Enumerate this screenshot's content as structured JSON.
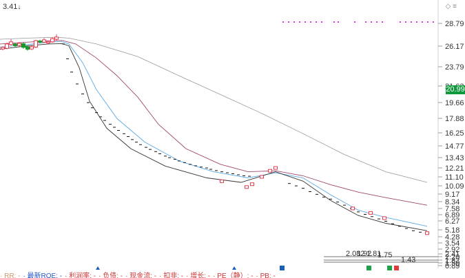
{
  "top_left_label": "3.41",
  "top_right_icons": [
    "diamond-icon",
    "menu-icon"
  ],
  "current_price": "20.99",
  "legend_bar": [
    "RR",
    "最新ROE",
    "利润率",
    "负债",
    "现金流",
    "扣非",
    "增长",
    "PE（静）",
    "PB"
  ],
  "chart_data": {
    "type": "line",
    "y_axis_ticks": [
      "28.79",
      "26.17",
      "23.79",
      "21.63",
      "19.66",
      "17.88",
      "16.25",
      "14.77",
      "13.43",
      "12.21",
      "11.10",
      "10.09",
      "9.17",
      "8.34",
      "7.58",
      "6.89",
      "6.27",
      "5.18",
      "4.28",
      "3.54",
      "2.92",
      "2.41",
      "2.20",
      "1.82",
      "1.50",
      "0.89"
    ],
    "y_scale": "log",
    "ylim": [
      0.89,
      30.5
    ],
    "annotations": [
      "2.082",
      "1.92",
      "1.81",
      "1.75",
      "1.43"
    ],
    "colors": {
      "up_candle": "#e8374a",
      "down_candle": "#109b2b",
      "ma_short": "#5aa9e6",
      "ma_mid": "#a0466e",
      "ma_long": "#333333",
      "ma_slow": "#999999",
      "price_tag": "#0e9a3c",
      "dots": "#d534d5"
    }
  }
}
